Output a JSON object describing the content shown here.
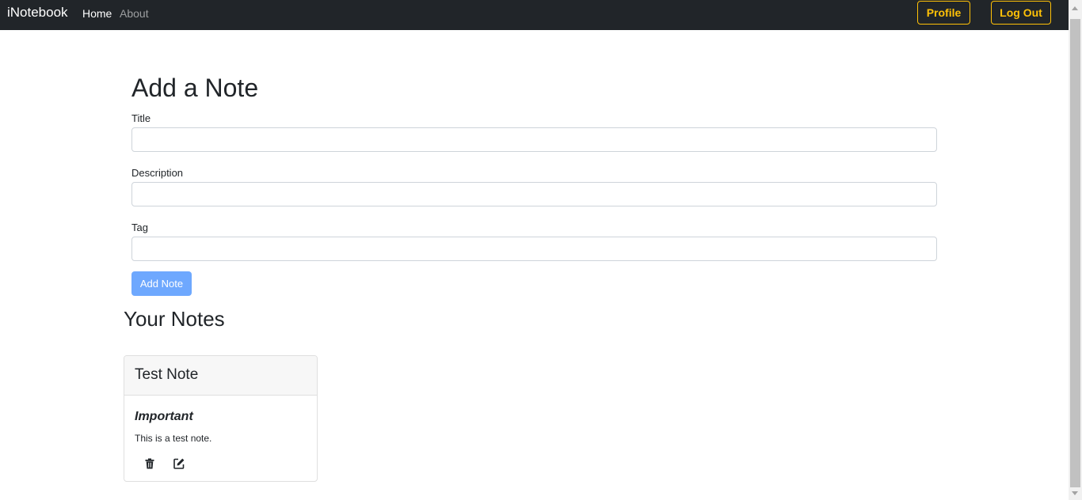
{
  "navbar": {
    "brand": "iNotebook",
    "links": [
      {
        "label": "Home",
        "active": true
      },
      {
        "label": "About",
        "active": false
      }
    ],
    "buttons": {
      "profile": "Profile",
      "logout": "Log Out"
    }
  },
  "form": {
    "heading": "Add a Note",
    "title_label": "Title",
    "title_value": "",
    "description_label": "Description",
    "description_value": "",
    "tag_label": "Tag",
    "tag_value": "",
    "submit_label": "Add Note"
  },
  "notes": {
    "heading": "Your Notes",
    "items": [
      {
        "title": "Test Note",
        "tag": "Important",
        "description": "This is a test note.",
        "icons": [
          "trash-icon",
          "edit-icon"
        ]
      }
    ]
  },
  "colors": {
    "navbar_bg": "#212529",
    "accent_warning": "#ffc107",
    "primary_disabled": "#6ea8fe"
  }
}
